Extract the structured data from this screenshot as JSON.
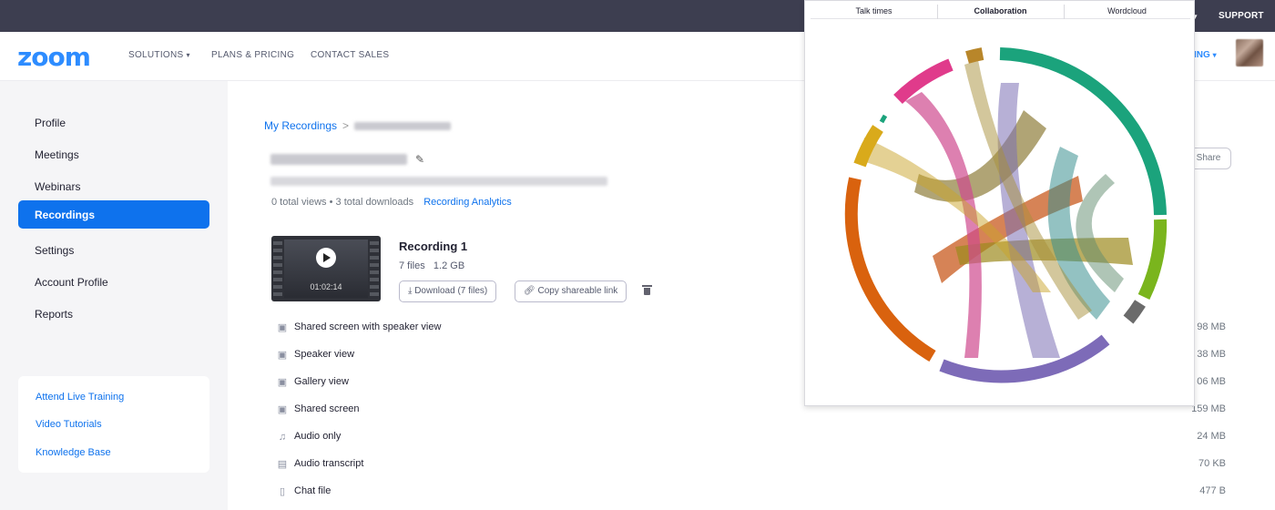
{
  "topbar": {
    "support_label": "SUPPORT"
  },
  "navbar": {
    "logo": "zoom",
    "links": [
      "SOLUTIONS",
      "PLANS & PRICING",
      "CONTACT SALES"
    ],
    "right_link_partial": "ING"
  },
  "sidebar": {
    "items": [
      "Profile",
      "Meetings",
      "Webinars",
      "Recordings",
      "Settings",
      "Account Profile",
      "Reports"
    ],
    "active": "Recordings",
    "help_links": [
      "Attend Live Training",
      "Video Tutorials",
      "Knowledge Base"
    ]
  },
  "breadcrumb": {
    "root": "My Recordings",
    "separator": ">"
  },
  "stats": {
    "views": "0 total views",
    "dot": "•",
    "downloads": "3 total downloads",
    "analytics_link": "Recording Analytics"
  },
  "recording": {
    "title": "Recording 1",
    "files_count": "7 files",
    "size": "1.2 GB",
    "duration": "01:02:14",
    "download_label": "Download (7 files)",
    "copy_link_label": "Copy shareable link"
  },
  "share_label": "Share",
  "files": [
    {
      "name": "Shared screen with speaker view",
      "size": "98 MB",
      "icon": "video-file-icon"
    },
    {
      "name": "Speaker view",
      "size": "38 MB",
      "icon": "video-file-icon"
    },
    {
      "name": "Gallery view",
      "size": "06 MB",
      "icon": "video-file-icon"
    },
    {
      "name": "Shared screen",
      "size": "159 MB",
      "icon": "video-file-icon"
    },
    {
      "name": "Audio only",
      "size": "24 MB",
      "icon": "music-note-icon"
    },
    {
      "name": "Audio transcript",
      "size": "70 KB",
      "icon": "transcript-icon"
    },
    {
      "name": "Chat file",
      "size": "477 B",
      "icon": "document-icon"
    }
  ],
  "popup": {
    "tabs": [
      "Talk times",
      "Collaboration",
      "Wordcloud"
    ],
    "selected_tab": "Collaboration"
  },
  "colors": {
    "accent": "#0e72ed",
    "logo": "#2d8cff",
    "topbar": "#3d3e50",
    "chord_segments": [
      "#1ba37c",
      "#7ab51d",
      "#6b6b6b",
      "#7d6bb8",
      "#d9620e",
      "#d9aa1b",
      "#1ba37c",
      "#e03b8b",
      "#b8862a"
    ]
  }
}
